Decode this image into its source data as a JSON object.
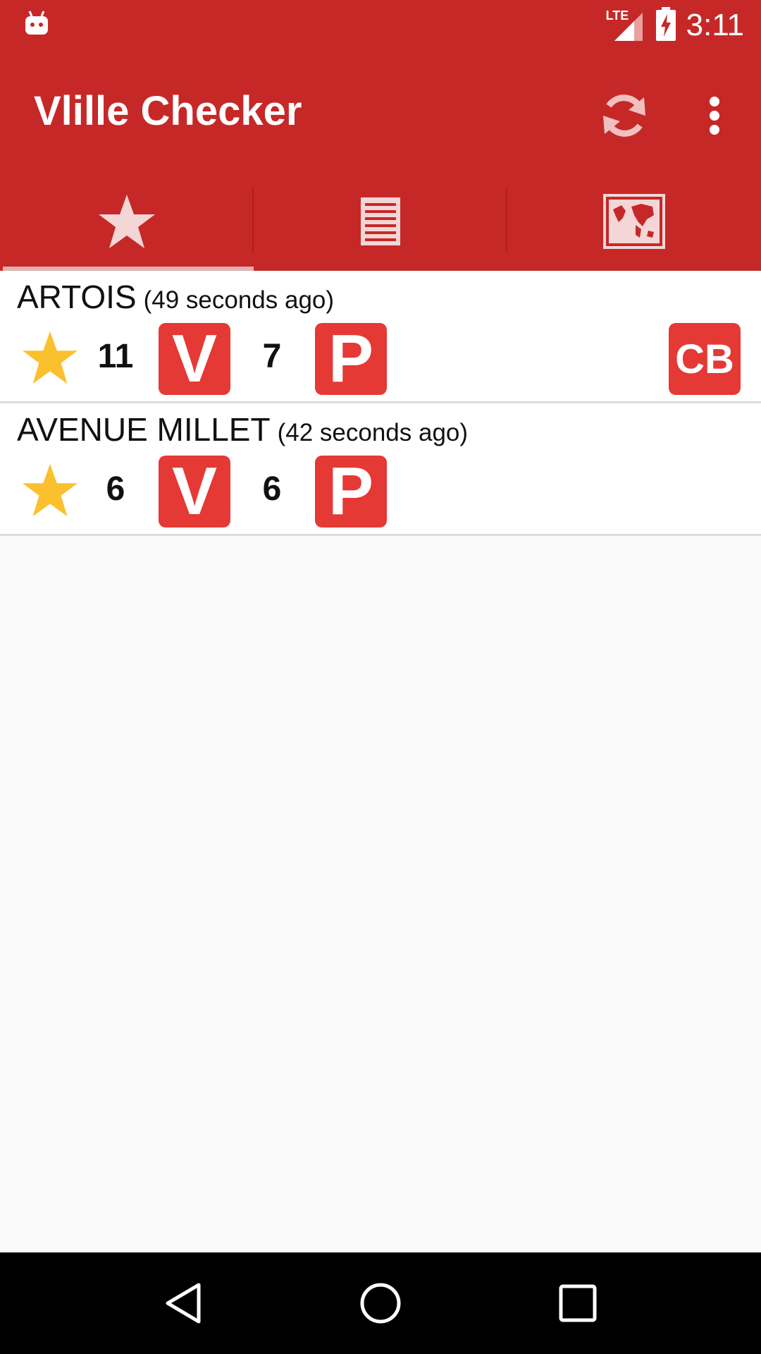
{
  "status_bar": {
    "time": "3:11",
    "network_label": "LTE",
    "icons": [
      "android-notification-icon",
      "lte-signal-icon",
      "battery-charging-icon"
    ]
  },
  "toolbar": {
    "title": "Vlille Checker",
    "actions": [
      "refresh-icon",
      "overflow-menu-icon"
    ]
  },
  "tabs": [
    {
      "icon": "star-icon",
      "selected": true
    },
    {
      "icon": "list-icon",
      "selected": false
    },
    {
      "icon": "map-icon",
      "selected": false
    }
  ],
  "stations": [
    {
      "name": "ARTOIS",
      "age": "(49 seconds ago)",
      "favorite": true,
      "bikes": "11",
      "bikes_badge": "V",
      "spots": "7",
      "spots_badge": "P",
      "card_badge": "CB"
    },
    {
      "name": "AVENUE MILLET",
      "age": "(42 seconds ago)",
      "favorite": true,
      "bikes": "6",
      "bikes_badge": "V",
      "spots": "6",
      "spots_badge": "P"
    }
  ],
  "nav_bar": {
    "buttons": [
      "back-icon",
      "home-icon",
      "recents-icon"
    ]
  },
  "colors": {
    "primary": "#c62828",
    "badge": "#e53935",
    "star": "#fbc02d",
    "background": "#fafafa"
  }
}
